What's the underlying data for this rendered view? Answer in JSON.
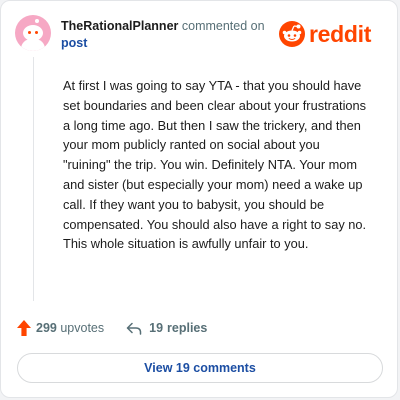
{
  "comment": {
    "username": "TheRationalPlanner",
    "action_text": "commented on",
    "target_link": "post",
    "body": "At first I was going to say YTA - that you should have set boundaries and been clear about your frustrations a long time ago. But then I saw the trickery, and then your mom publicly ranted on social about you \"ruining\" the trip. You win. Definitely NTA. Your mom and sister (but especially your mom) need a wake up call. If they want you to babysit, you should be compensated. You should also have a right to say no. This whole situation is awfully unfair to you."
  },
  "brand": {
    "name": "reddit",
    "accent_color": "#ff4500"
  },
  "actions": {
    "upvote_count": "299",
    "upvote_label": "upvotes",
    "reply_count": "19",
    "reply_label": "replies"
  },
  "view_comments_label": "View 19 comments",
  "icons": {
    "avatar": "snoo-avatar",
    "upvote": "upvote-arrow-icon",
    "reply": "reply-arrow-icon",
    "logo": "reddit-snoo-logo"
  }
}
